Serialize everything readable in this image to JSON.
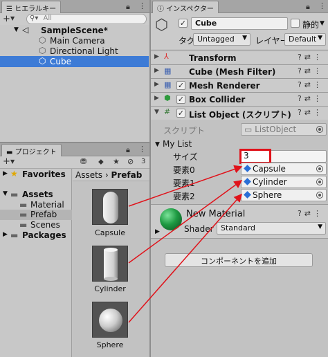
{
  "hierarchy": {
    "tab_label": "ヒエラルキー",
    "search_placeholder": "All",
    "add_symbol": "+",
    "items": [
      {
        "label": "SampleScene*"
      },
      {
        "label": "Main Camera"
      },
      {
        "label": "Directional Light"
      },
      {
        "label": "Cube"
      }
    ]
  },
  "project": {
    "tab_label": "プロジェクト",
    "add_symbol": "+",
    "hidden_count": "3",
    "tree": [
      {
        "label": "Favorites"
      },
      {
        "label": "Assets"
      },
      {
        "label": "Material"
      },
      {
        "label": "Prefab"
      },
      {
        "label": "Scenes"
      },
      {
        "label": "Packages"
      }
    ],
    "breadcrumb": {
      "root": "Assets",
      "separator": "›",
      "current": "Prefab"
    },
    "assets": [
      {
        "label": "Capsule"
      },
      {
        "label": "Cylinder"
      },
      {
        "label": "Sphere"
      }
    ]
  },
  "inspector": {
    "tab_label": "インスペクター",
    "object_name": "Cube",
    "static_label": "静的",
    "tag_label": "タグ",
    "tag_value": "Untagged",
    "layer_label": "レイヤー",
    "layer_value": "Default",
    "components": [
      {
        "title": "Transform"
      },
      {
        "title": "Cube (Mesh Filter)"
      },
      {
        "title": "Mesh Renderer"
      },
      {
        "title": "Box Collider"
      },
      {
        "title": "List Object (スクリプト)"
      }
    ],
    "script_label": "スクリプト",
    "script_value": "ListObject",
    "list_label": "My List",
    "size_label": "サイズ",
    "size_value": "3",
    "elements": [
      {
        "label": "要素0",
        "value": "Capsule"
      },
      {
        "label": "要素1",
        "value": "Cylinder"
      },
      {
        "label": "要素2",
        "value": "Sphere"
      }
    ],
    "material_name": "New Material",
    "shader_label": "Shader",
    "shader_value": "Standard",
    "add_component_label": "コンポーネントを追加"
  },
  "colors": {
    "selection": "#3d7bd6",
    "annotation": "#e0121a",
    "material_green": "#1e9a42"
  }
}
